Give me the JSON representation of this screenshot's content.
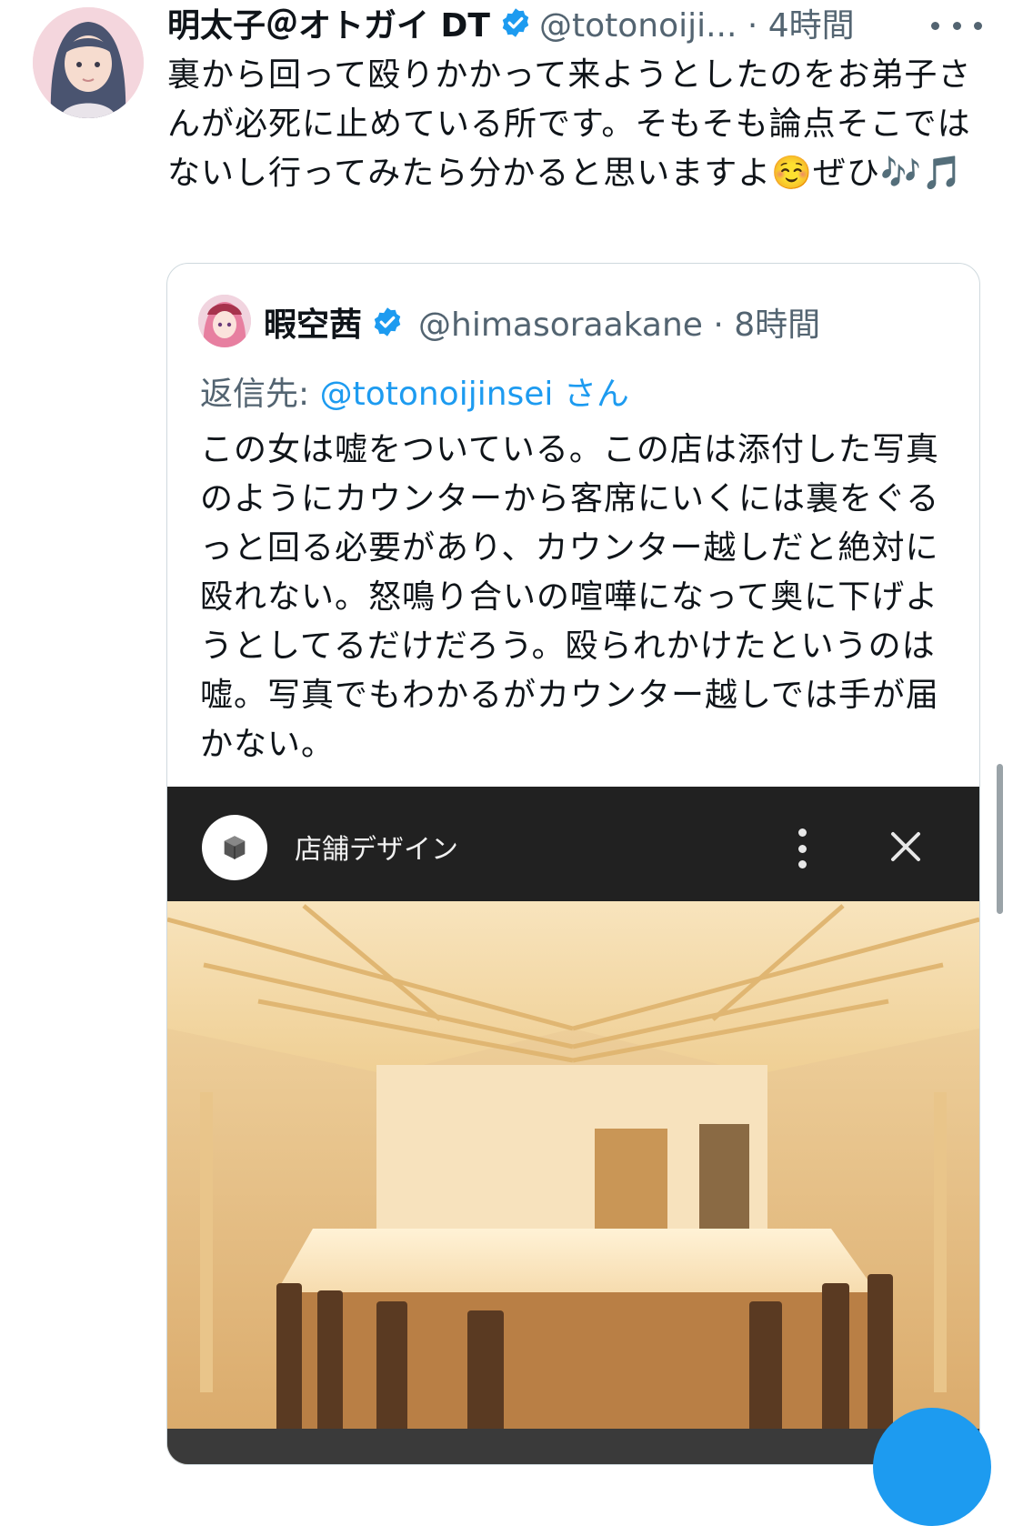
{
  "tweet": {
    "author_name": "明太子＠オトガイ DT",
    "handle_meta": "@totonoiji... · 4時間",
    "text": "裏から回って殴りかかって来ようとしたのをお弟子さんが必死に止めている所です。そもそも論点そこではないし行ってみたら分かると思いますよ☺️ぜひ🎶🎵",
    "avatar_icon": "user-avatar",
    "verified_icon": "verified-badge-icon",
    "more_icon": "more-dots-icon"
  },
  "quote": {
    "author_name": "暇空茜",
    "handle_meta": "@himasoraakane · 8時間",
    "reply_prefix": "返信先: ",
    "reply_handle": "@totonoijinsei",
    "reply_suffix": " さん",
    "text": "この女は嘘をついている。この店は添付した写真のようにカウンターから客席にいくには裏をぐるっと回る必要があり、カウンター越しだと絶対に殴れない。怒鳴り合いの喧嘩になって奥に下げようとしてるだけだろう。殴られかけたというのは嘘。写真でもわかるがカウンター越しでは手が届かない。"
  },
  "media": {
    "site_title": "店舗デザイン",
    "logo_icon": "box-logo-icon",
    "kebab_icon": "kebab-menu-icon",
    "close_icon": "close-icon",
    "photo_description_icon": "restaurant-counter-photo"
  },
  "colors": {
    "link": "#1d9bf0",
    "secondary_text": "#536471",
    "primary_text": "#0f1419",
    "border": "#cfd9de"
  }
}
